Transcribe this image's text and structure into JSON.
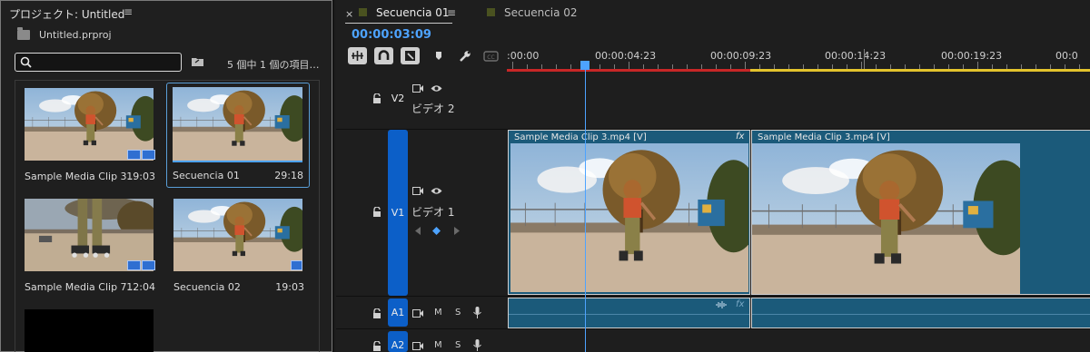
{
  "project": {
    "title": "プロジェクト: Untitled",
    "menu_glyph": "≡",
    "file_name": "Untitled.prproj",
    "search_placeholder": "",
    "items_count": "5 個中 1 個の項目…",
    "items": [
      {
        "name": "Sample Media Clip 3...",
        "duration": "19:03",
        "kind": "clip",
        "selected": false
      },
      {
        "name": "Secuencia 01",
        "duration": "29:18",
        "kind": "sequence",
        "selected": true
      },
      {
        "name": "Sample Media Clip 7...",
        "duration": "12:04",
        "kind": "clip",
        "selected": false
      },
      {
        "name": "Secuencia 02",
        "duration": "19:03",
        "kind": "sequence",
        "selected": false
      }
    ]
  },
  "timeline": {
    "close_glyph": "×",
    "tabs": [
      {
        "label": "Secuencia 01",
        "active": true,
        "menu_glyph": "≡"
      },
      {
        "label": "Secuencia 02",
        "active": false
      }
    ],
    "timecode": "00:00:03:09",
    "ruler_labels": [
      ":00:00",
      "00:00:04:23",
      "00:00:09:23",
      "00:00:14:23",
      "00:00:19:23",
      "00:0"
    ],
    "tracks": {
      "v2": {
        "target": "V2",
        "name": "ビデオ 2"
      },
      "v1": {
        "target": "V1",
        "name": "ビデオ 1"
      },
      "a1": {
        "target": "A1",
        "mute": "M",
        "solo": "S"
      },
      "a2": {
        "target": "A2",
        "mute": "M",
        "solo": "S"
      }
    },
    "clips": [
      {
        "label": "Sample Media Clip 3.mp4 [V]",
        "fx": "fx"
      },
      {
        "label": "Sample Media Clip 3.mp4 [V]",
        "fx": ""
      }
    ],
    "audio_fx": "fx",
    "colors": {
      "accent": "#4da3ff",
      "track_blue": "#0c5fc8",
      "clip": "#1b5a7a",
      "in_out_red": "#c82727",
      "in_out_yellow": "#e3c32c"
    }
  }
}
